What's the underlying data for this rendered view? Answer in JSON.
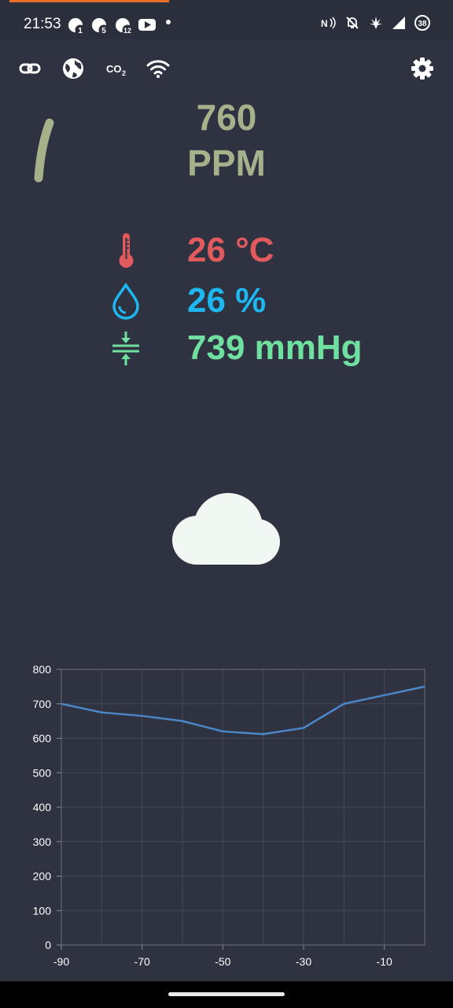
{
  "status_bar": {
    "time": "21:53",
    "notification_badges": [
      "1",
      "5",
      "12"
    ],
    "battery_level": "38",
    "icons": [
      "nfc-icon",
      "bell-off-icon",
      "cannabis-icon",
      "signal-icon",
      "battery-icon"
    ]
  },
  "toolbar": {
    "icons": [
      "link-icon",
      "globe-icon",
      "co2-icon",
      "wifi-icon",
      "gear-icon"
    ],
    "co2_text": "CO",
    "co2_sub": "2"
  },
  "co2": {
    "value": "760",
    "unit": "PPM",
    "color": "#a5b18a"
  },
  "readings": {
    "temperature": {
      "value": "26 °C",
      "icon": "thermometer-icon",
      "color": "#e05a5e"
    },
    "humidity": {
      "value": "26 %",
      "icon": "water-drop-icon",
      "color": "#1db8f0"
    },
    "pressure": {
      "value": "739 mmHg",
      "icon": "pressure-icon",
      "color": "#6fe0a0"
    }
  },
  "weather": {
    "icon": "cloud-icon",
    "color": "#f1f7f3"
  },
  "chart_data": {
    "type": "line",
    "x": [
      -90,
      -80,
      -70,
      -60,
      -50,
      -40,
      -30,
      -20,
      -10,
      0
    ],
    "series": [
      {
        "values": [
          700,
          675,
          665,
          650,
          620,
          612,
          630,
          700,
          725,
          750
        ],
        "color": "#4a86c8"
      }
    ],
    "xlim": [
      -90,
      0
    ],
    "ylim": [
      0,
      800
    ],
    "x_ticks": [
      "-90",
      "-70",
      "-50",
      "-30",
      "-10"
    ],
    "x_tick_values": [
      -90,
      -70,
      -50,
      -30,
      -10
    ],
    "y_ticks": [
      "0",
      "100",
      "200",
      "300",
      "400",
      "500",
      "600",
      "700",
      "800"
    ],
    "y_tick_values": [
      0,
      100,
      200,
      300,
      400,
      500,
      600,
      700,
      800
    ],
    "grid": true
  }
}
